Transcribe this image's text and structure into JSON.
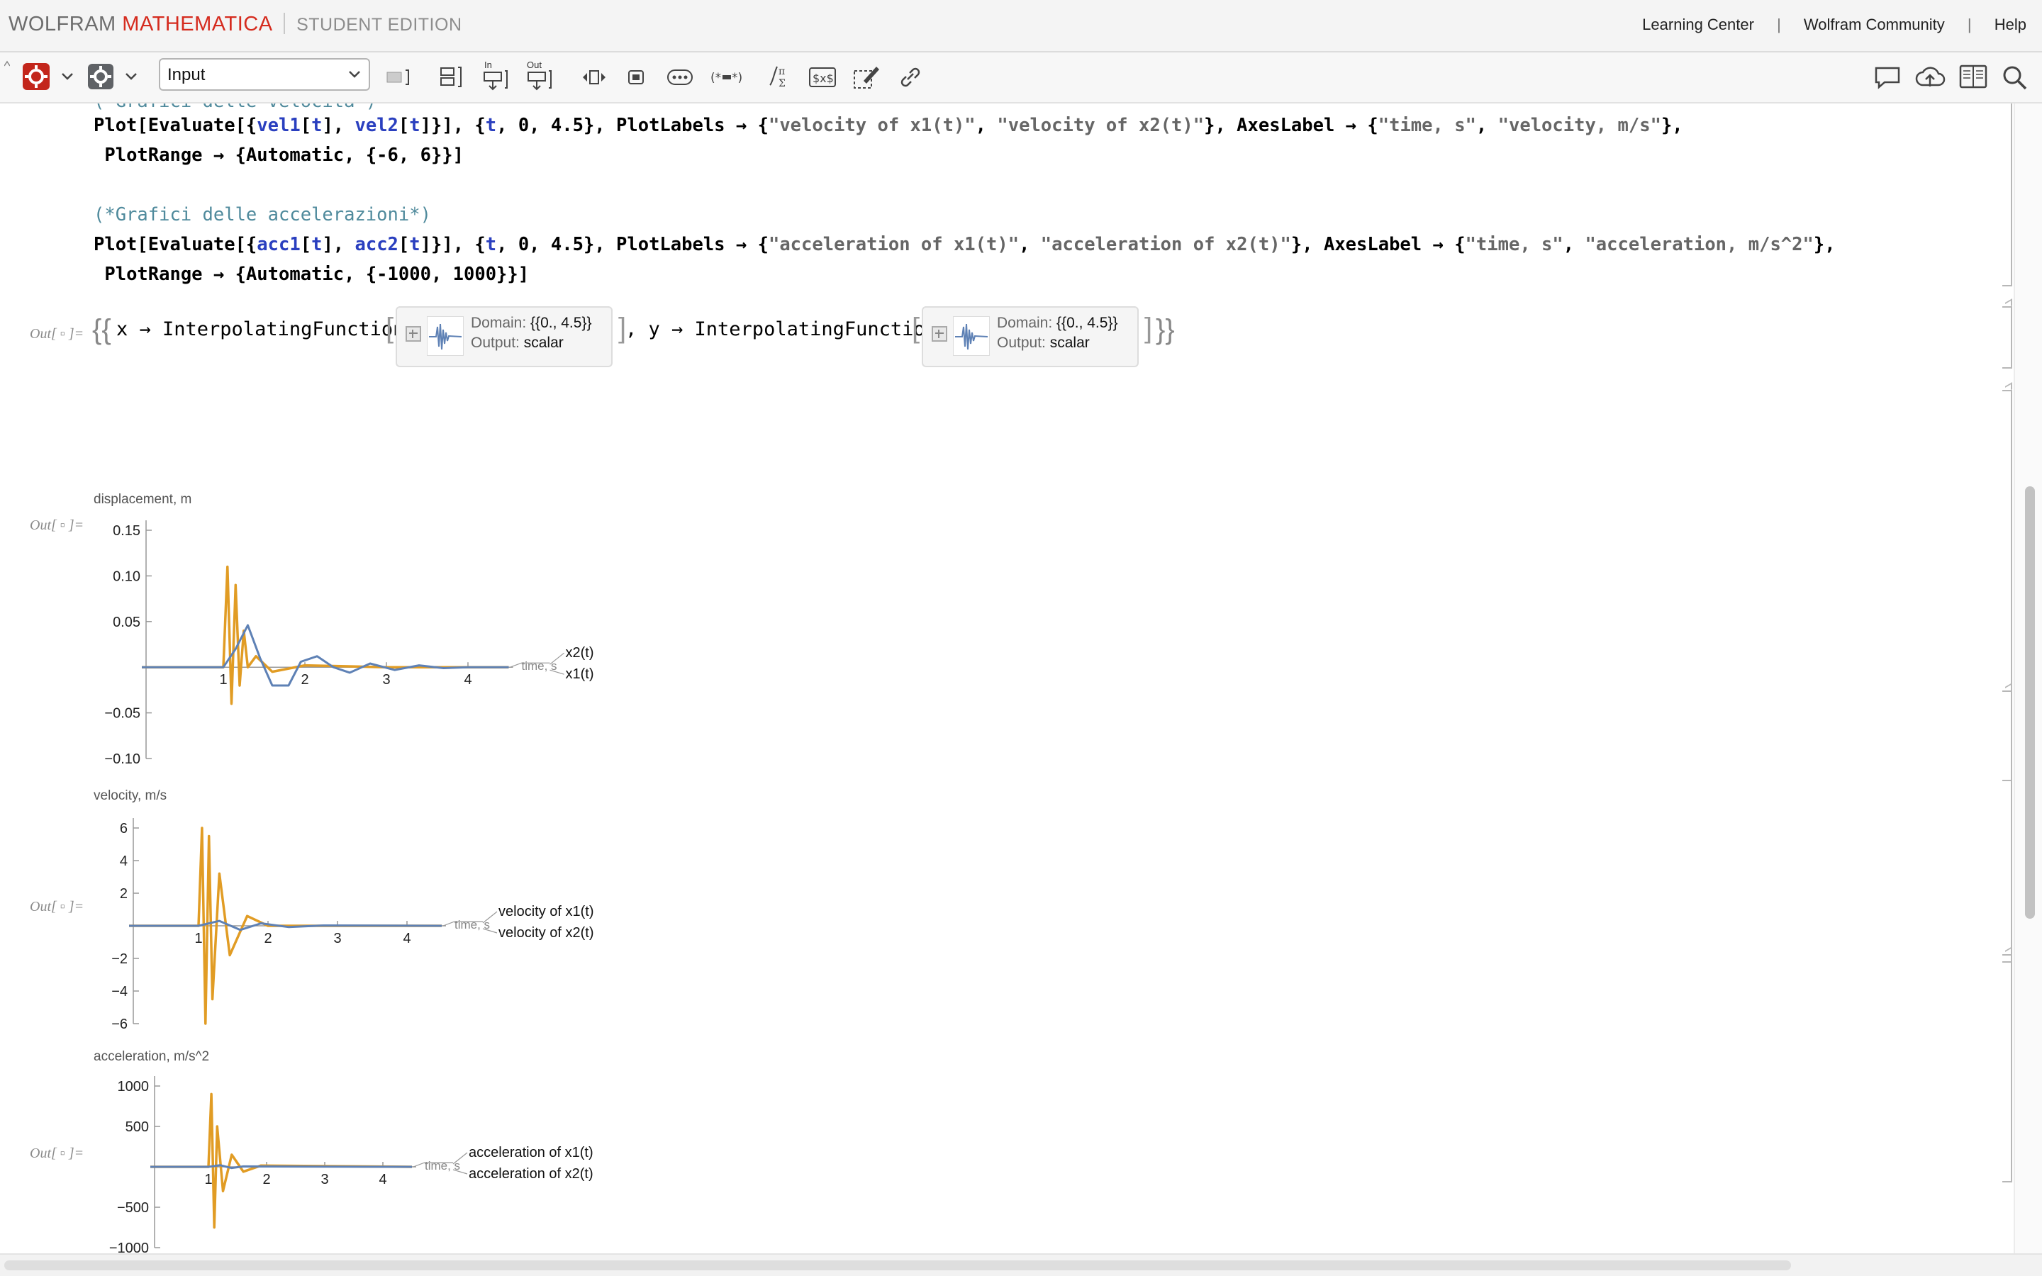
{
  "titlebar": {
    "brand_wolfram": "WOLFRAM",
    "brand_mathematica": "MATHEMATICA",
    "brand_edition": "STUDENT EDITION",
    "links": [
      "Learning Center",
      "Wolfram Community",
      "Help"
    ],
    "separator": "|"
  },
  "toolbar": {
    "style_value": "Input",
    "icons": [
      "evaluate-gear-icon",
      "notebook-settings-icon",
      "cell-bracket-icon",
      "split-cells-icon",
      "input-below-icon",
      "output-below-icon",
      "template-input-icon",
      "iconize-icon",
      "ellipsis-icon",
      "placeholder-icon",
      "math-typesetting-icon",
      "text-with-math-icon",
      "drawing-tools-icon",
      "hyperlink-icon",
      "chat-icon",
      "cloud-upload-icon",
      "documentation-icon",
      "search-icon"
    ],
    "in_label": "In",
    "out_label": "Out"
  },
  "notebook": {
    "partial_comment": "(*Grafici delle velocità*)",
    "line1": [
      "Plot[Evaluate[{",
      "vel1",
      "[",
      "t",
      "], ",
      "vel2",
      "[",
      "t",
      "]}], {",
      "t",
      ", 0, 4.5}, ",
      "PlotLabels",
      " → {",
      "\"velocity of x1(t)\"",
      ", ",
      "\"velocity of x2(t)\"",
      "}, ",
      "AxesLabel",
      " → {",
      "\"time, s\"",
      ", ",
      "\"velocity, m/s\"",
      "},"
    ],
    "line2": [
      " ",
      "PlotRange",
      " → {",
      "Automatic",
      ", {-6, 6}}]"
    ],
    "comment2": "(*Grafici delle accelerazioni*)",
    "line3": [
      "Plot[Evaluate[{",
      "acc1",
      "[",
      "t",
      "], ",
      "acc2",
      "[",
      "t",
      "]}], {",
      "t",
      ", 0, 4.5}, ",
      "PlotLabels",
      " → {",
      "\"acceleration of x1(t)\"",
      ", ",
      "\"acceleration of x2(t)\"",
      "}, ",
      "AxesLabel",
      " → {",
      "\"time, s\"",
      ", ",
      "\"acceleration, m/s^2\"",
      "},"
    ],
    "line4": [
      " ",
      "PlotRange",
      " → {",
      "Automatic",
      ", {-1000, 1000}}]"
    ],
    "out_label": "Out[ ▫ ]=",
    "interp": {
      "open": "{{",
      "x_part": "x → InterpolatingFunction",
      "y_part": ", y → InterpolatingFunction",
      "close": "}}",
      "domain_label": "Domain:",
      "domain_value": "{{0., 4.5}}",
      "output_label": "Output:",
      "output_value": "scalar"
    }
  },
  "chart_data": [
    {
      "type": "line",
      "ylabel": "displacement, m",
      "xlabel": "time, s",
      "xlim": [
        0,
        4.5
      ],
      "ylim": [
        -0.1,
        0.15
      ],
      "xticks": [
        1,
        2,
        3,
        4
      ],
      "yticks": [
        -0.1,
        -0.05,
        0.05,
        0.1,
        0.15
      ],
      "ytick_labels": [
        "−0.10",
        "−0.05",
        "0.05",
        "0.10",
        "0.15"
      ],
      "series": [
        {
          "name": "x2(t)",
          "color": "#e19c24",
          "x": [
            0,
            1.0,
            1.05,
            1.1,
            1.15,
            1.2,
            1.25,
            1.3,
            1.4,
            1.6,
            2.0,
            3.0,
            4.5
          ],
          "y": [
            0,
            0,
            0.11,
            -0.04,
            0.09,
            -0.02,
            0.04,
            0.0,
            0.012,
            -0.005,
            0.002,
            0.0,
            0.0
          ]
        },
        {
          "name": "x1(t)",
          "color": "#5e81b5",
          "x": [
            0,
            1.0,
            1.15,
            1.3,
            1.45,
            1.6,
            1.8,
            1.95,
            2.15,
            2.35,
            2.55,
            2.8,
            3.1,
            3.4,
            3.7,
            4.0,
            4.5
          ],
          "y": [
            0,
            0,
            0.02,
            0.046,
            0.01,
            -0.02,
            -0.02,
            0.006,
            0.012,
            0.0,
            -0.006,
            0.004,
            -0.003,
            0.002,
            -0.001,
            0.0,
            0.0
          ]
        }
      ]
    },
    {
      "type": "line",
      "ylabel": "velocity, m/s",
      "xlabel": "time, s",
      "xlim": [
        0,
        4.5
      ],
      "ylim": [
        -6,
        6
      ],
      "xticks": [
        1,
        2,
        3,
        4
      ],
      "yticks": [
        -6,
        -4,
        -2,
        2,
        4,
        6
      ],
      "ytick_labels": [
        "−6",
        "−4",
        "−2",
        "2",
        "4",
        "6"
      ],
      "series": [
        {
          "name": "velocity of x1(t)",
          "color": "#e19c24",
          "x": [
            0,
            1.0,
            1.05,
            1.1,
            1.15,
            1.2,
            1.3,
            1.45,
            1.7,
            2.0,
            4.5
          ],
          "y": [
            0,
            0,
            6,
            -6,
            5.5,
            -4.5,
            3.2,
            -1.8,
            0.6,
            0,
            0
          ]
        },
        {
          "name": "velocity of x2(t)",
          "color": "#5e81b5",
          "x": [
            0,
            1.0,
            1.3,
            1.6,
            1.9,
            2.3,
            2.8,
            4.5
          ],
          "y": [
            0,
            0,
            0.3,
            -0.25,
            0.15,
            -0.08,
            0.02,
            0
          ]
        }
      ]
    },
    {
      "type": "line",
      "ylabel": "acceleration, m/s^2",
      "xlabel": "time, s",
      "xlim": [
        0,
        4.5
      ],
      "ylim": [
        -1000,
        1000
      ],
      "xticks": [
        1,
        2,
        3,
        4
      ],
      "yticks": [
        -1000,
        -500,
        500,
        1000
      ],
      "ytick_labels": [
        "−1000",
        "−500",
        "500",
        "1000"
      ],
      "series": [
        {
          "name": "acceleration of x1(t)",
          "color": "#e19c24",
          "x": [
            0,
            1.0,
            1.05,
            1.1,
            1.15,
            1.25,
            1.4,
            1.6,
            1.9,
            4.5
          ],
          "y": [
            0,
            0,
            900,
            -750,
            500,
            -300,
            150,
            -60,
            15,
            0
          ]
        },
        {
          "name": "acceleration of x2(t)",
          "color": "#5e81b5",
          "x": [
            0,
            1.0,
            1.2,
            1.4,
            1.6,
            4.5
          ],
          "y": [
            0,
            0,
            20,
            -15,
            5,
            0
          ]
        }
      ]
    }
  ]
}
